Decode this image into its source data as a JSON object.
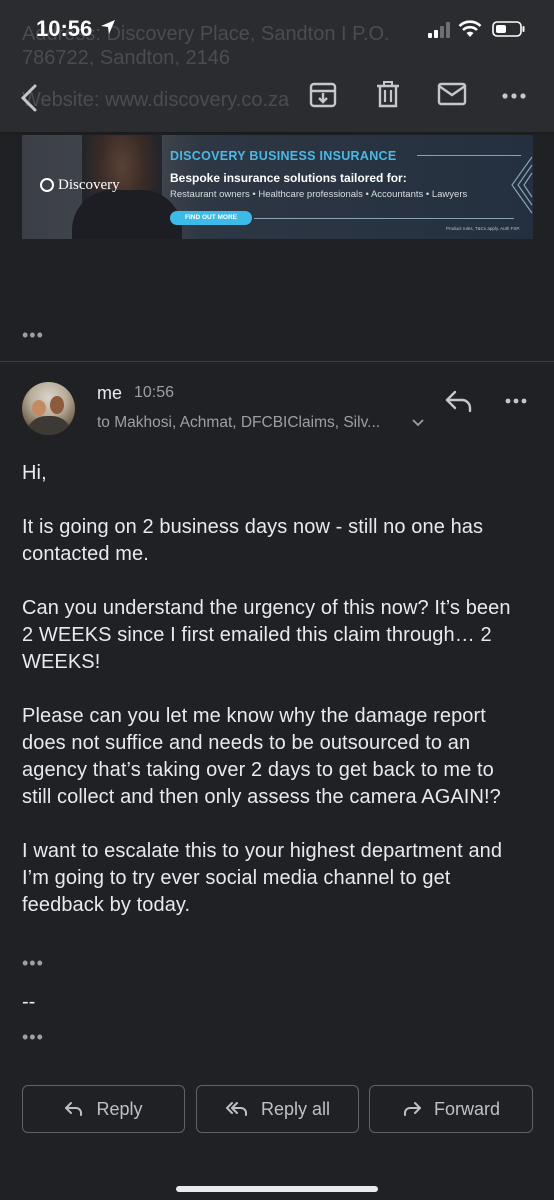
{
  "status_bar": {
    "time": "10:56"
  },
  "background_header": {
    "line1": "Address: Discovery Place, Sandton I P.O.",
    "line2": "786722, Sandton, 2146",
    "line3": "Website: www.discovery.co.za"
  },
  "toolbar": {
    "icons": [
      "back-icon",
      "archive-icon",
      "trash-icon",
      "mail-icon",
      "more-icon"
    ]
  },
  "banner": {
    "brand": "Discovery",
    "title": "DISCOVERY BUSINESS INSURANCE",
    "subtitle": "Bespoke insurance solutions tailored for:",
    "list": "Restaurant owners • Healthcare professionals • Accountants • Lawyers",
    "cta": "FIND OUT MORE",
    "fine_print": "Product rules, T&Cs apply. Auth FSP."
  },
  "message": {
    "sender": "me",
    "time": "10:56",
    "recipients": "to Makhosi, Achmat, DFCBIClaims, Silv...",
    "body": [
      "Hi,",
      "It is going on 2 business days now - still no one has contacted me.",
      "Can you understand the urgency of this now? It’s been 2 WEEKS since I first emailed this claim through… 2 WEEKS!",
      "Please can you let me know why the damage report does not suffice and needs to be outsourced to an agency that’s taking over 2 days to get back to me to still collect and then only assess the camera AGAIN!?",
      "I want to escalate this to your highest department and I’m going to try ever social media channel to get feedback by today."
    ],
    "signature_separator": "--"
  },
  "actions": {
    "reply": "Reply",
    "reply_all": "Reply all",
    "forward": "Forward"
  },
  "colors": {
    "background": "#202124",
    "text": "#e8eaed",
    "muted": "#9aa0a6",
    "banner_accent": "#49b9e6"
  }
}
